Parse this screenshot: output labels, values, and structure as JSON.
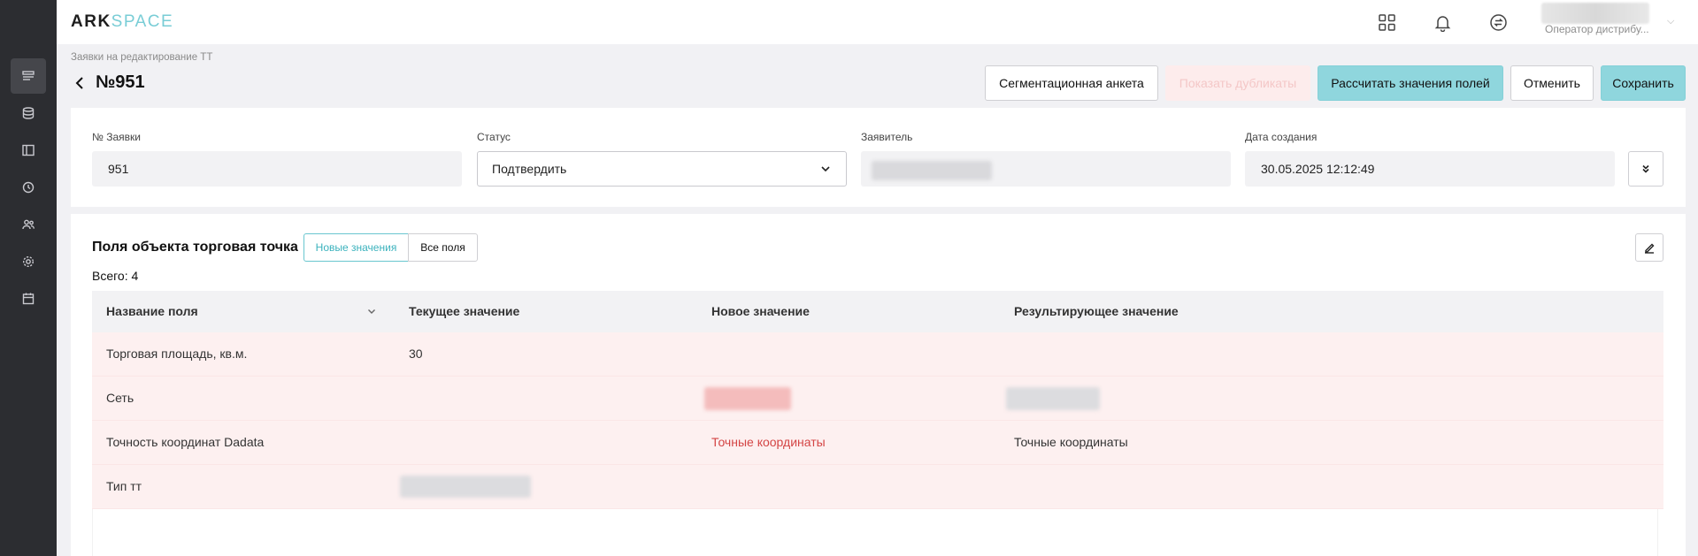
{
  "app": {
    "logo_main": "ARK",
    "logo_accent": "SPACE"
  },
  "sidebar": {
    "items": [
      {
        "icon": "list-icon",
        "active": true
      },
      {
        "icon": "database-icon",
        "active": false
      },
      {
        "icon": "layout-icon",
        "active": false
      },
      {
        "icon": "clock-icon",
        "active": false
      },
      {
        "icon": "users-icon",
        "active": false
      },
      {
        "icon": "gear-icon",
        "active": false
      },
      {
        "icon": "calendar-icon",
        "active": false
      }
    ]
  },
  "topbar": {
    "user_role": "Оператор дистрибу..."
  },
  "header": {
    "breadcrumb": "Заявки на редактирование ТТ",
    "title": "№951",
    "buttons": {
      "segmentation": "Сегментационная анкета",
      "show_duplicates": "Показать дубликаты",
      "calculate": "Рассчитать значения полей",
      "cancel": "Отменить",
      "save": "Сохранить"
    }
  },
  "request_info": {
    "number": {
      "label": "№ Заявки",
      "value": "951"
    },
    "status": {
      "label": "Статус",
      "value": "Подтвердить"
    },
    "applicant": {
      "label": "Заявитель",
      "value": ""
    },
    "created": {
      "label": "Дата создания",
      "value": "30.05.2025 12:12:49"
    }
  },
  "fields_section": {
    "title": "Поля объекта торговая точка",
    "toggle_new": "Новые значения",
    "toggle_all": "Все поля",
    "total": "Всего: 4",
    "columns": [
      "Название поля",
      "Текущее значение",
      "Новое значение",
      "Результирующее значение"
    ],
    "rows": [
      {
        "name": "Торговая площадь, кв.м.",
        "current": "30",
        "new": "",
        "result": ""
      },
      {
        "name": "Сеть",
        "current": "",
        "new": "",
        "result": ""
      },
      {
        "name": "Точность координат Dadata",
        "current": "",
        "new": "Точные координаты",
        "result": "Точные координаты"
      },
      {
        "name": "Тип тт",
        "current": "",
        "new": "",
        "result": ""
      }
    ]
  },
  "colors": {
    "accent": "#8fd6dd",
    "sidebar_bg": "#2c2d31",
    "changed_row": "#fdf0f0",
    "new_value_text": "#d44545"
  }
}
